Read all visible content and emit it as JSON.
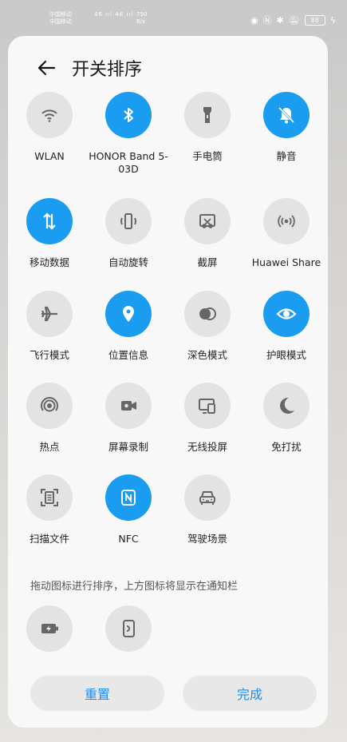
{
  "status_bar": {
    "carrier1": "中国移动",
    "carrier2": "中国移动",
    "signal": "46.ııl 46.ııl",
    "speed_value": "750",
    "speed_unit": "B/s",
    "battery": "88"
  },
  "header": {
    "title": "开关排序"
  },
  "tiles": [
    {
      "label": "WLAN",
      "icon": "wifi-icon",
      "on": false
    },
    {
      "label": "HONOR Band 5-03D",
      "icon": "bluetooth-icon",
      "on": true
    },
    {
      "label": "手电筒",
      "icon": "flashlight-icon",
      "on": false
    },
    {
      "label": "静音",
      "icon": "bell-off-icon",
      "on": true
    },
    {
      "label": "移动数据",
      "icon": "mobile-data-icon",
      "on": true
    },
    {
      "label": "自动旋转",
      "icon": "auto-rotate-icon",
      "on": false
    },
    {
      "label": "截屏",
      "icon": "screenshot-icon",
      "on": false
    },
    {
      "label": "Huawei Share",
      "icon": "huawei-share-icon",
      "on": false
    },
    {
      "label": "飞行模式",
      "icon": "airplane-icon",
      "on": false
    },
    {
      "label": "位置信息",
      "icon": "location-icon",
      "on": true
    },
    {
      "label": "深色模式",
      "icon": "dark-mode-icon",
      "on": false
    },
    {
      "label": "护眼模式",
      "icon": "eye-comfort-icon",
      "on": true
    },
    {
      "label": "热点",
      "icon": "hotspot-icon",
      "on": false
    },
    {
      "label": "屏幕录制",
      "icon": "screen-record-icon",
      "on": false
    },
    {
      "label": "无线投屏",
      "icon": "wireless-projection-icon",
      "on": false
    },
    {
      "label": "免打扰",
      "icon": "moon-icon",
      "on": false
    },
    {
      "label": "扫描文件",
      "icon": "scan-document-icon",
      "on": false
    },
    {
      "label": "NFC",
      "icon": "nfc-icon",
      "on": true
    },
    {
      "label": "驾驶场景",
      "icon": "car-icon",
      "on": false
    }
  ],
  "hint": "拖动图标进行排序，上方图标将显示在通知栏",
  "extra_tiles": [
    {
      "icon": "battery-saver-icon"
    },
    {
      "icon": "phone-clone-icon"
    }
  ],
  "buttons": {
    "reset": "重置",
    "done": "完成"
  },
  "colors": {
    "accent": "#1a9cf0",
    "tile_off": "#e3e3e3",
    "button_text": "#1a8ff0"
  }
}
